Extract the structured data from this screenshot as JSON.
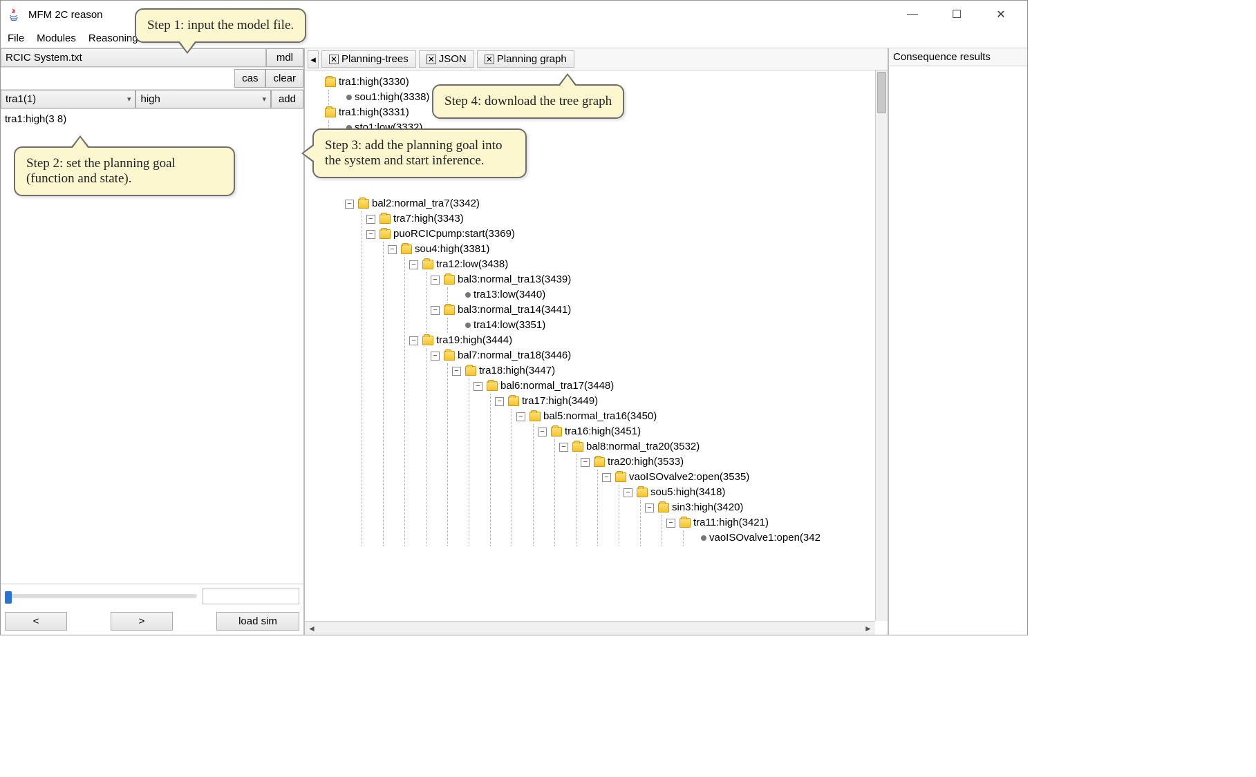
{
  "window": {
    "title": "MFM 2C reason"
  },
  "menubar": [
    "File",
    "Modules",
    "Reasoning"
  ],
  "left": {
    "file": "RCIC System.txt",
    "btn_mdl": "mdl",
    "btn_cas": "cas",
    "btn_clear": "clear",
    "sel_func": "tra1(1)",
    "sel_state": "high",
    "btn_add": "add",
    "goal_item": "tra1:high(3   8)",
    "btn_prev": "<",
    "btn_next": ">",
    "btn_load": "load sim"
  },
  "tabs": {
    "t1": "Planning-trees",
    "t2": "JSON",
    "t3": "Planning graph"
  },
  "conseq_header": "Consequence results",
  "callouts": {
    "c1": "Step 1: input the model file.",
    "c2": "Step 2: set the planning goal (function and state).",
    "c3": "Step 3: add the planning goal into the system and start inference.",
    "c4": "Step 4: download the tree graph"
  },
  "tree": {
    "n0": "tra1:high(3330)",
    "n0_0": "sou1:high(3338)",
    "n1": "tra1:high(3331)",
    "n1_0": "sto1:low(3332)",
    "n_hidden": "bal2:normal_tra7(3342)",
    "n2": "tra7:high(3343)",
    "n3": "puoRCICpump:start(3369)",
    "n4": "sou4:high(3381)",
    "n5": "tra12:low(3438)",
    "n6": "bal3:normal_tra13(3439)",
    "n6_0": "tra13:low(3440)",
    "n7": "bal3:normal_tra14(3441)",
    "n7_0": "tra14:low(3351)",
    "n8": "tra19:high(3444)",
    "n9": "bal7:normal_tra18(3446)",
    "n10": "tra18:high(3447)",
    "n11": "bal6:normal_tra17(3448)",
    "n12": "tra17:high(3449)",
    "n13": "bal5:normal_tra16(3450)",
    "n14": "tra16:high(3451)",
    "n15": "bal8:normal_tra20(3532)",
    "n16": "tra20:high(3533)",
    "n17": "vaoISOvalve2:open(3535)",
    "n18": "sou5:high(3418)",
    "n19": "sin3:high(3420)",
    "n20": "tra11:high(3421)",
    "n21": "vaoISOvalve1:open(342"
  }
}
